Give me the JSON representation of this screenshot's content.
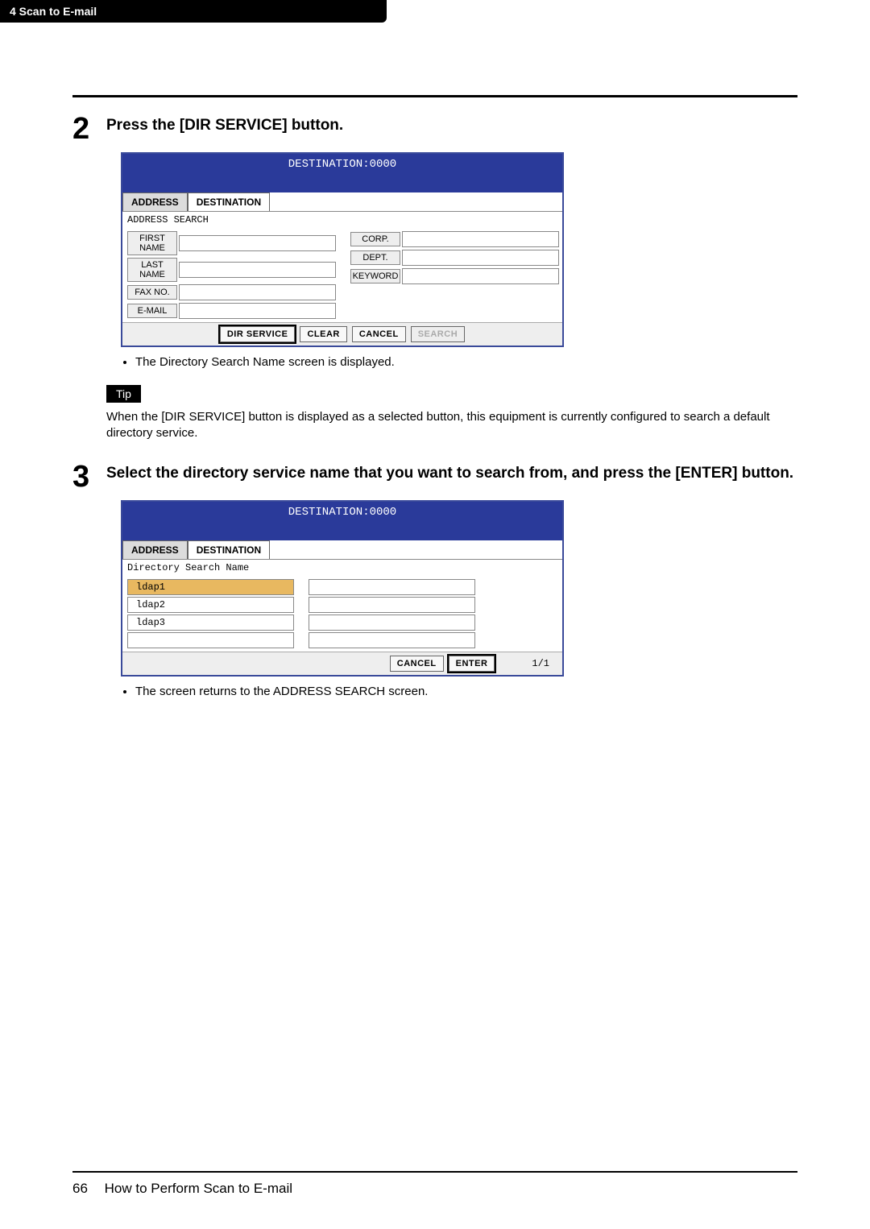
{
  "header": {
    "chapter": "4   Scan to E-mail"
  },
  "step2": {
    "num": "2",
    "title": "Press the [DIR SERVICE] button.",
    "dest_banner": "DESTINATION:0000",
    "tab_address": "ADDRESS",
    "tab_destination": "DESTINATION",
    "subheading": "ADDRESS SEARCH",
    "labels": {
      "first_name": "FIRST NAME",
      "last_name": "LAST NAME",
      "fax_no": "FAX NO.",
      "email": "E-MAIL",
      "corp": "CORP.",
      "dept": "DEPT.",
      "keyword": "KEYWORD"
    },
    "buttons": {
      "dir_service": "DIR SERVICE",
      "clear": "CLEAR",
      "cancel": "CANCEL",
      "search": "SEARCH"
    },
    "bullet": "The Directory Search Name screen is displayed."
  },
  "tip": {
    "label": "Tip",
    "text": "When the [DIR SERVICE] button is displayed as a selected button, this equipment is currently configured to search a default directory service."
  },
  "step3": {
    "num": "3",
    "title": "Select the directory service name that you want to search from, and press the [ENTER] button.",
    "dest_banner": "DESTINATION:0000",
    "tab_address": "ADDRESS",
    "tab_destination": "DESTINATION",
    "subheading": "Directory Search Name",
    "items": [
      "ldap1",
      "ldap2",
      "ldap3"
    ],
    "buttons": {
      "cancel": "CANCEL",
      "enter": "ENTER"
    },
    "pager": "1/1",
    "bullet": "The screen returns to the ADDRESS SEARCH screen."
  },
  "footer": {
    "page": "66",
    "title": "How to Perform Scan to E-mail"
  }
}
